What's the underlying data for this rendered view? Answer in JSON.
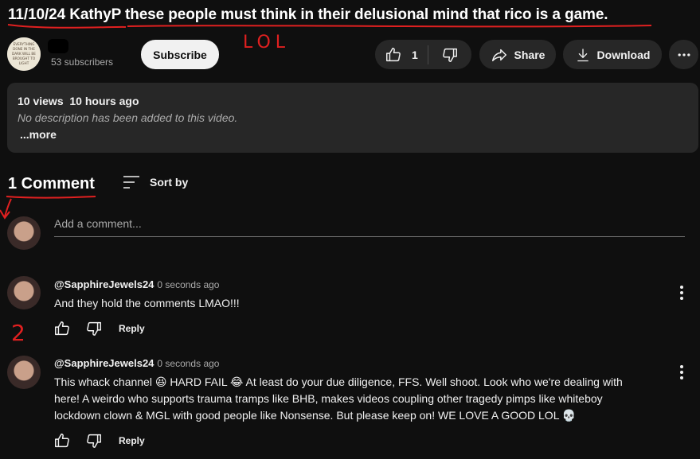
{
  "video": {
    "title": "11/10/24 KathyP these people must think in their delusional mind that rico is a game."
  },
  "channel": {
    "subscribers": "53 subscribers",
    "avatar_text": [
      "EVERYTHING",
      "DONE IN THE",
      "DARK WILL BE",
      "BROUGHT TO",
      "LIGHT"
    ]
  },
  "actions": {
    "subscribe": "Subscribe",
    "like_count": "1",
    "share": "Share",
    "download": "Download"
  },
  "description": {
    "views": "10 views",
    "age": "10 hours ago",
    "text": "No description has been added to this video.",
    "more": "...more"
  },
  "comments": {
    "count_label": "1 Comment",
    "sort_label": "Sort by",
    "add_placeholder": "Add a comment...",
    "items": [
      {
        "author": "@SapphireJewels24",
        "time": "0 seconds ago",
        "text": "And they hold the comments LMAO!!!",
        "reply": "Reply"
      },
      {
        "author": "@SapphireJewels24",
        "time": "0 seconds ago",
        "text_lines": [
          "This whack channel 😆 HARD FAIL 😂 At least do your due diligence, FFS. Well shoot. Look who we're dealing with",
          "here! A weirdo who supports trauma tramps like BHB, makes videos coupling other tragedy pimps like whiteboy",
          "lockdown clown & MGL with good people like Nonsense. But please keep on! WE LOVE A GOOD LOL 💀"
        ],
        "reply": "Reply"
      }
    ]
  },
  "annotations": {
    "lol": "LOL",
    "two": "2",
    "color": "#e02020"
  }
}
